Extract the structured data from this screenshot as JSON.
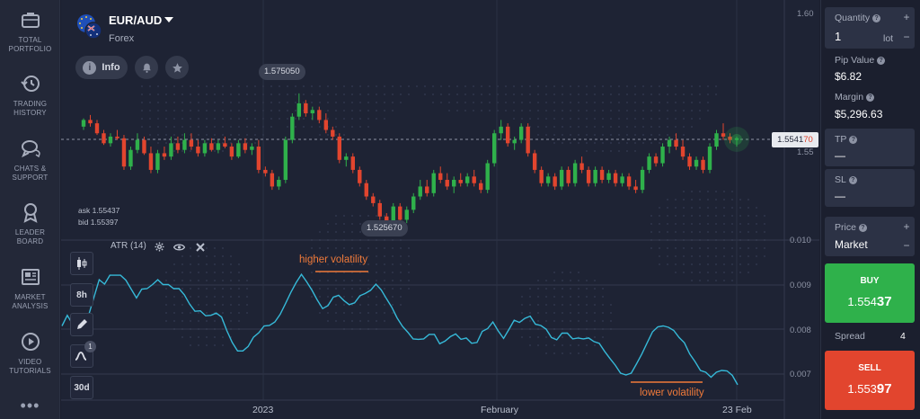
{
  "sidebar": {
    "items": [
      {
        "label_1": "TOTAL",
        "label_2": "PORTFOLIO",
        "icon": "briefcase-icon"
      },
      {
        "label_1": "TRADING",
        "label_2": "HISTORY",
        "icon": "history-icon"
      },
      {
        "label_1": "CHATS &",
        "label_2": "SUPPORT",
        "icon": "chat-icon"
      },
      {
        "label_1": "LEADER",
        "label_2": "BOARD",
        "icon": "award-icon"
      },
      {
        "label_1": "MARKET",
        "label_2": "ANALYSIS",
        "icon": "newspaper-icon"
      },
      {
        "label_1": "VIDEO",
        "label_2": "TUTORIALS",
        "icon": "play-icon"
      }
    ],
    "more": "•••"
  },
  "asset": {
    "name": "EUR/AUD",
    "type": "Forex",
    "info_label": "Info"
  },
  "price_info": {
    "high": "1.575050",
    "low": "1.525670",
    "ask": "ask 1.55437",
    "bid": "bid 1.55397",
    "current_main": "1.5541",
    "current_tail": "70"
  },
  "axes": {
    "price_ticks": [
      "1.60",
      "1.55"
    ],
    "atr_ticks": [
      "0.010",
      "0.009",
      "0.008",
      "0.007"
    ],
    "time_ticks": [
      "2023",
      "February",
      "23 Feb"
    ]
  },
  "indicator": {
    "label": "ATR (14)"
  },
  "annotations": {
    "high": "higher volatility",
    "low": "lower volatility"
  },
  "tools": {
    "timeframe": "8h",
    "period": "30d",
    "badge": "1"
  },
  "panel": {
    "quantity_label": "Quantity",
    "quantity_value": "1",
    "quantity_unit": "lot",
    "pip_label": "Pip Value",
    "pip_value": "$6.82",
    "margin_label": "Margin",
    "margin_value": "$5,296.63",
    "tp_label": "TP",
    "tp_value": "—",
    "sl_label": "SL",
    "sl_value": "—",
    "price_label": "Price",
    "price_value": "Market",
    "buy_label": "BUY",
    "buy_main": "1.554",
    "buy_tail": "37",
    "spread_label": "Spread",
    "spread_value": "4",
    "sell_label": "SELL",
    "sell_main": "1.553",
    "sell_tail": "97"
  },
  "colors": {
    "up": "#2fb14b",
    "down": "#e2452e",
    "atr_line": "#36b9d8",
    "accent_orange": "#f07a3a"
  },
  "chart_data": {
    "type": "line",
    "title": "",
    "series": [
      {
        "name": "ATR (14)",
        "values": [
          0.00808,
          0.00832,
          0.00812,
          0.00822,
          0.00798,
          0.00832,
          0.00872,
          0.00912,
          0.00902,
          0.00922,
          0.00922,
          0.00922,
          0.00911,
          0.00891,
          0.00871,
          0.00891,
          0.00892,
          0.00901,
          0.00912,
          0.00901,
          0.00901,
          0.00892,
          0.00892,
          0.00878,
          0.00857,
          0.00841,
          0.00842,
          0.00831,
          0.00832,
          0.00837,
          0.00828,
          0.00797,
          0.00771,
          0.00752,
          0.00752,
          0.00762,
          0.00783,
          0.00793,
          0.00808,
          0.00809,
          0.00817,
          0.00834,
          0.00858,
          0.00883,
          0.00905,
          0.00924,
          0.00907,
          0.00888,
          0.00866,
          0.00847,
          0.00854,
          0.00873,
          0.00877,
          0.00865,
          0.00856,
          0.0086,
          0.00876,
          0.00881,
          0.00888,
          0.00902,
          0.00889,
          0.00869,
          0.0085,
          0.00826,
          0.00807,
          0.00794,
          0.00779,
          0.00778,
          0.00779,
          0.00789,
          0.00789,
          0.00768,
          0.00774,
          0.00784,
          0.0079,
          0.00778,
          0.00781,
          0.00769,
          0.00771,
          0.00796,
          0.00802,
          0.00817,
          0.00797,
          0.0078,
          0.008,
          0.00821,
          0.00816,
          0.00825,
          0.0083,
          0.00812,
          0.00809,
          0.00801,
          0.00782,
          0.00777,
          0.00792,
          0.00792,
          0.00779,
          0.00781,
          0.00779,
          0.00781,
          0.00773,
          0.00769,
          0.00751,
          0.00735,
          0.0072,
          0.00702,
          0.00698,
          0.00702,
          0.00723,
          0.00745,
          0.0077,
          0.00795,
          0.00806,
          0.00808,
          0.00805,
          0.00798,
          0.00782,
          0.0077,
          0.00745,
          0.00728,
          0.00708,
          0.00704,
          0.00693,
          0.00704,
          0.00708,
          0.00707,
          0.00697,
          0.00676
        ]
      }
    ],
    "ylim": [
      0.0066,
      0.01
    ],
    "price_ylim": [
      1.51,
      1.6
    ],
    "candles": [
      [
        1.558,
        1.5605,
        1.557,
        1.56
      ],
      [
        1.56,
        1.5615,
        1.558,
        1.559
      ],
      [
        1.559,
        1.56,
        1.5555,
        1.556
      ],
      [
        1.556,
        1.557,
        1.5525,
        1.553
      ],
      [
        1.553,
        1.556,
        1.552,
        1.555
      ],
      [
        1.555,
        1.557,
        1.554,
        1.5545
      ],
      [
        1.5545,
        1.5555,
        1.545,
        1.546
      ],
      [
        1.546,
        1.552,
        1.545,
        1.551
      ],
      [
        1.551,
        1.556,
        1.55,
        1.554
      ],
      [
        1.554,
        1.555,
        1.5495,
        1.55
      ],
      [
        1.55,
        1.552,
        1.544,
        1.545
      ],
      [
        1.545,
        1.551,
        1.544,
        1.55
      ],
      [
        1.55,
        1.552,
        1.548,
        1.549
      ],
      [
        1.549,
        1.555,
        1.548,
        1.553
      ],
      [
        1.553,
        1.555,
        1.55,
        1.551
      ],
      [
        1.551,
        1.556,
        1.55,
        1.554
      ],
      [
        1.554,
        1.556,
        1.551,
        1.552
      ],
      [
        1.552,
        1.554,
        1.549,
        1.55
      ],
      [
        1.55,
        1.554,
        1.549,
        1.553
      ],
      [
        1.553,
        1.5545,
        1.5505,
        1.551
      ],
      [
        1.551,
        1.554,
        1.55,
        1.553
      ],
      [
        1.553,
        1.555,
        1.5515,
        1.552
      ],
      [
        1.552,
        1.553,
        1.548,
        1.549
      ],
      [
        1.549,
        1.554,
        1.5485,
        1.553
      ],
      [
        1.553,
        1.5545,
        1.55,
        1.551
      ],
      [
        1.551,
        1.553,
        1.5495,
        1.552
      ],
      [
        1.552,
        1.554,
        1.544,
        1.545
      ],
      [
        1.545,
        1.546,
        1.543,
        1.544
      ],
      [
        1.544,
        1.545,
        1.539,
        1.54
      ],
      [
        1.54,
        1.543,
        1.539,
        1.542
      ],
      [
        1.542,
        1.555,
        1.541,
        1.554
      ],
      [
        1.554,
        1.562,
        1.553,
        1.561
      ],
      [
        1.561,
        1.568,
        1.56,
        1.565
      ],
      [
        1.565,
        1.566,
        1.561,
        1.562
      ],
      [
        1.562,
        1.564,
        1.56,
        1.563
      ],
      [
        1.563,
        1.564,
        1.559,
        1.56
      ],
      [
        1.56,
        1.562,
        1.556,
        1.557
      ],
      [
        1.557,
        1.558,
        1.554,
        1.555
      ],
      [
        1.555,
        1.556,
        1.547,
        1.548
      ],
      [
        1.548,
        1.55,
        1.546,
        1.549
      ],
      [
        1.549,
        1.55,
        1.544,
        1.545
      ],
      [
        1.545,
        1.546,
        1.54,
        1.541
      ],
      [
        1.541,
        1.542,
        1.536,
        1.537
      ],
      [
        1.537,
        1.538,
        1.534,
        1.535
      ],
      [
        1.535,
        1.536,
        1.53,
        1.531
      ],
      [
        1.531,
        1.532,
        1.526,
        1.528
      ],
      [
        1.528,
        1.535,
        1.527,
        1.534
      ],
      [
        1.534,
        1.535,
        1.529,
        1.53
      ],
      [
        1.53,
        1.534,
        1.529,
        1.533
      ],
      [
        1.533,
        1.538,
        1.532,
        1.537
      ],
      [
        1.537,
        1.542,
        1.536,
        1.54
      ],
      [
        1.54,
        1.542,
        1.537,
        1.538
      ],
      [
        1.538,
        1.545,
        1.537,
        1.544
      ],
      [
        1.544,
        1.546,
        1.541,
        1.542
      ],
      [
        1.542,
        1.544,
        1.539,
        1.54
      ],
      [
        1.54,
        1.543,
        1.538,
        1.542
      ],
      [
        1.542,
        1.544,
        1.54,
        1.541
      ],
      [
        1.541,
        1.544,
        1.54,
        1.543
      ],
      [
        1.543,
        1.545,
        1.54,
        1.541
      ],
      [
        1.541,
        1.542,
        1.538,
        1.539
      ],
      [
        1.539,
        1.548,
        1.538,
        1.547
      ],
      [
        1.547,
        1.557,
        1.546,
        1.556
      ],
      [
        1.556,
        1.56,
        1.554,
        1.558
      ],
      [
        1.558,
        1.559,
        1.552,
        1.553
      ],
      [
        1.553,
        1.555,
        1.551,
        1.554
      ],
      [
        1.554,
        1.559,
        1.553,
        1.558
      ],
      [
        1.558,
        1.559,
        1.549,
        1.55
      ],
      [
        1.55,
        1.551,
        1.544,
        1.545
      ],
      [
        1.545,
        1.546,
        1.54,
        1.541
      ],
      [
        1.541,
        1.544,
        1.54,
        1.543
      ],
      [
        1.543,
        1.544,
        1.539,
        1.54
      ],
      [
        1.54,
        1.546,
        1.539,
        1.545
      ],
      [
        1.545,
        1.546,
        1.54,
        1.541
      ],
      [
        1.541,
        1.548,
        1.54,
        1.547
      ],
      [
        1.547,
        1.549,
        1.544,
        1.545
      ],
      [
        1.545,
        1.546,
        1.54,
        1.541
      ],
      [
        1.541,
        1.546,
        1.54,
        1.545
      ],
      [
        1.545,
        1.546,
        1.541,
        1.542
      ],
      [
        1.542,
        1.545,
        1.541,
        1.544
      ],
      [
        1.544,
        1.545,
        1.54,
        1.541
      ],
      [
        1.541,
        1.544,
        1.54,
        1.543
      ],
      [
        1.543,
        1.544,
        1.539,
        1.54
      ],
      [
        1.54,
        1.542,
        1.538,
        1.539
      ],
      [
        1.539,
        1.546,
        1.538,
        1.545
      ],
      [
        1.545,
        1.55,
        1.544,
        1.549
      ],
      [
        1.549,
        1.55,
        1.546,
        1.547
      ],
      [
        1.547,
        1.553,
        1.546,
        1.552
      ],
      [
        1.552,
        1.555,
        1.55,
        1.554
      ],
      [
        1.554,
        1.556,
        1.551,
        1.552
      ],
      [
        1.552,
        1.554,
        1.548,
        1.549
      ],
      [
        1.549,
        1.55,
        1.545,
        1.546
      ],
      [
        1.546,
        1.549,
        1.545,
        1.548
      ],
      [
        1.548,
        1.549,
        1.544,
        1.545
      ],
      [
        1.545,
        1.553,
        1.544,
        1.552
      ],
      [
        1.552,
        1.557,
        1.551,
        1.556
      ],
      [
        1.556,
        1.559,
        1.554,
        1.555
      ],
      [
        1.555,
        1.556,
        1.553,
        1.554
      ],
      [
        1.554,
        1.555,
        1.552,
        1.5545
      ]
    ]
  }
}
